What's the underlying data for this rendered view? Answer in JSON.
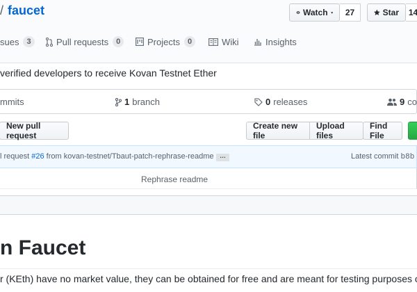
{
  "repo": {
    "slash": "/",
    "name": "faucet"
  },
  "actions": {
    "watch_label": "Watch",
    "watch_count": "27",
    "star_label": "Star",
    "star_count": "14"
  },
  "tabs": [
    {
      "label": "sues",
      "count": "3",
      "icon": "issue-icon"
    },
    {
      "label": "Pull requests",
      "count": "0",
      "icon": "pull-request-icon"
    },
    {
      "label": "Projects",
      "count": "0",
      "icon": "project-icon"
    },
    {
      "label": "Wiki",
      "icon": "wiki-icon"
    },
    {
      "label": "Insights",
      "icon": "insights-icon"
    }
  ],
  "description": "verified developers to receive Kovan Testnet Ether",
  "summary": {
    "commits_label": "mmits",
    "branch_count": "1",
    "branch_label": "branch",
    "releases_count": "0",
    "releases_label": "releases",
    "contributors_count": "9",
    "contributors_label": "co"
  },
  "file_nav": {
    "new_pull_request": "New pull request",
    "create_new_file": "Create new file",
    "upload_files": "Upload files",
    "find_file": "Find File"
  },
  "commit": {
    "prefix": "l request ",
    "pr_link": "#26",
    "middle": " from kovan-testnet/Tbaut-patch-rephrase-readme",
    "ellipsis": "…",
    "latest_label": "Latest commit ",
    "sha": "b8b"
  },
  "file_row": {
    "message": "Rephrase readme"
  },
  "readme": {
    "title": "n Faucet",
    "paragraph": "r (KEth) have no market value, they can be obtained for free and are meant for testing purposes only."
  }
}
